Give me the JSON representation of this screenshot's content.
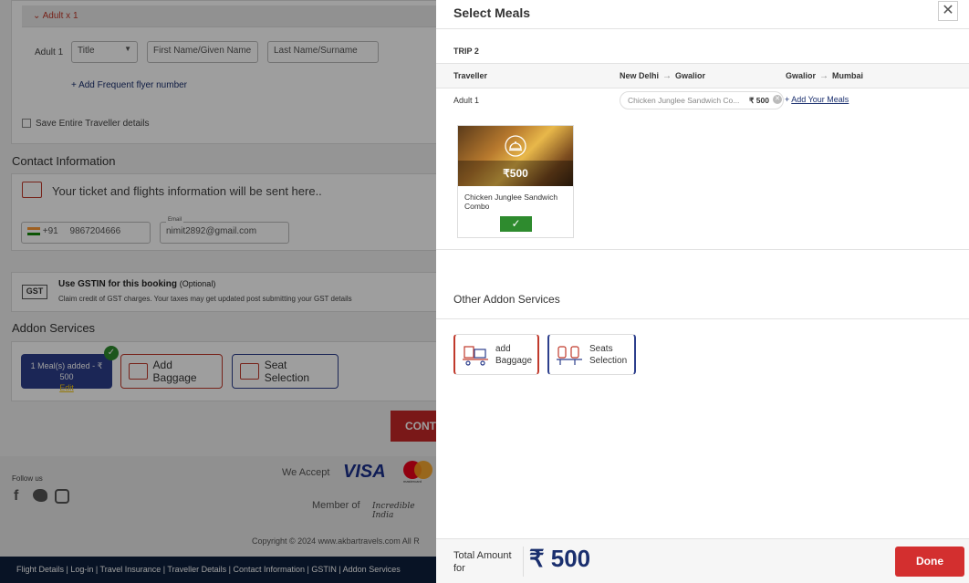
{
  "bg": {
    "adult_bar": "Adult x 1",
    "adult_label": "Adult 1",
    "title_select": "Title",
    "first_name_placeholder": "First Name/Given Name",
    "last_name_placeholder": "Last Name/Surname",
    "frequent_flyer": "+ Add Frequent flyer number",
    "save_traveller": "Save Entire Traveller details",
    "contact_title": "Contact Information",
    "contact_msg": "Your ticket and flights information will be sent here..",
    "country_code": "+91",
    "phone": "9867204666",
    "email_label": "Email",
    "email": "nimit2892@gmail.com",
    "gst_title": "Use GSTIN for this booking",
    "gst_optional": "(Optional)",
    "gst_desc": "Claim credit of GST charges. Your taxes may get updated post submitting your GST details",
    "gst_icon_text": "GST",
    "addon_title": "Addon Services",
    "meal_added": "1 Meal(s) added - ₹ 500",
    "meal_edit": "Edit",
    "add_baggage": "Add Baggage",
    "seat_selection": "Seat Selection",
    "continue": "CONT",
    "follow_us": "Follow us",
    "we_accept": "We Accept",
    "visa": "VISA",
    "mastercard": "mastercard",
    "member_of": "Member of",
    "incredible_india": "Incredible India",
    "copyright": "Copyright © 2024 www.akbartravels.com All R",
    "nav_links": "Flight Details  |  Log-in  |  Travel Insurance  |  Traveller Details  |  Contact Information  |  GSTIN  |  Addon Services"
  },
  "modal": {
    "title": "Select Meals",
    "trip": "TRIP 2",
    "col_traveller": "Traveller",
    "seg1_from": "New Delhi",
    "seg1_to": "Gwalior",
    "seg2_from": "Gwalior",
    "seg2_to": "Mumbai",
    "adult": "Adult 1",
    "selected_meal": "Chicken Junglee Sandwich Co...",
    "selected_price": "₹ 500",
    "add_meals": "Add Your Meals",
    "card_price": "₹500",
    "card_name": "Chicken Junglee Sandwich Combo",
    "other_title": "Other Addon Services",
    "svc_baggage_1": "add",
    "svc_baggage_2": "Baggage",
    "svc_seats_1": "Seats",
    "svc_seats_2": "Selection",
    "total_label": "Total Amount for",
    "total_amount": "₹ 500",
    "done": "Done"
  }
}
